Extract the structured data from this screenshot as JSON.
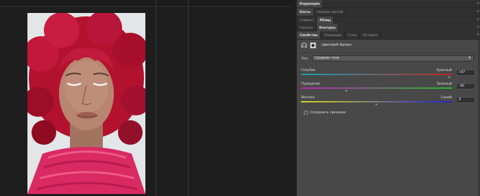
{
  "panel": {
    "group1": {
      "tabs": [
        {
          "label": "Коррекция",
          "active": true
        }
      ]
    },
    "group2": {
      "tabs": [
        {
          "label": "Кисть",
          "active": true
        },
        {
          "label": "Наборы кистей",
          "active": false
        }
      ]
    },
    "group3": {
      "tabs": [
        {
          "label": "Символ",
          "active": false
        },
        {
          "label": "Абзац",
          "active": true
        }
      ]
    },
    "group4": {
      "tabs": [
        {
          "label": "Каналы",
          "active": false
        },
        {
          "label": "Контуры",
          "active": true
        }
      ]
    },
    "group5": {
      "tabs": [
        {
          "label": "Свойства",
          "active": true
        },
        {
          "label": "Операции",
          "active": false
        },
        {
          "label": "Слои",
          "active": false
        },
        {
          "label": "История",
          "active": false
        }
      ]
    },
    "close_glyph": "«"
  },
  "properties": {
    "title": "Цветовой баланс",
    "tone_label": "Тон:",
    "tone_value": "Средние тона",
    "sliders": [
      {
        "left": "Голубая",
        "right": "Красный",
        "value": "+97",
        "position": 0.985,
        "gradient": [
          "#19a3b5",
          "#c02525"
        ]
      },
      {
        "left": "Пурпурная",
        "right": "Зеленый",
        "value": "-40",
        "position": 0.3,
        "gradient": [
          "#c020c0",
          "#20c020"
        ]
      },
      {
        "left": "Желтая",
        "right": "Синий",
        "value": "0",
        "position": 0.5,
        "gradient": [
          "#d8d820",
          "#2020d8"
        ]
      }
    ],
    "preserve_label": "Сохранить свечение",
    "preserve_checked": "✓"
  },
  "colors": {
    "panel_bg": "#484848",
    "hair": "#c0163a",
    "scarf": "#e0306a"
  },
  "icons": [
    "adjustment-layer-icon",
    "mask-icon",
    "dropdown-arrow-icon",
    "checkbox-icon",
    "panel-collapse-icon"
  ]
}
